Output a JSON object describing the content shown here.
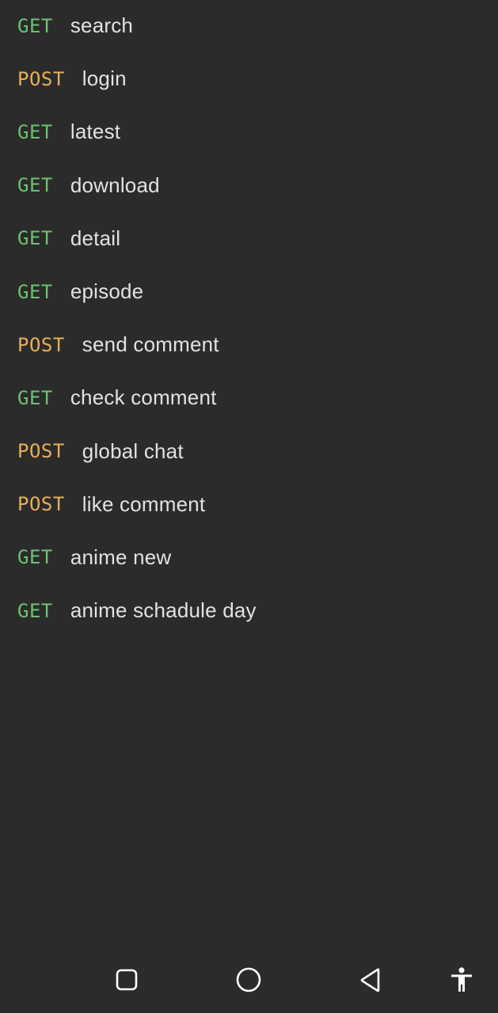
{
  "endpoints": [
    {
      "method": "GET",
      "name": "search"
    },
    {
      "method": "POST",
      "name": "login"
    },
    {
      "method": "GET",
      "name": "latest"
    },
    {
      "method": "GET",
      "name": "download"
    },
    {
      "method": "GET",
      "name": "detail"
    },
    {
      "method": "GET",
      "name": "episode"
    },
    {
      "method": "POST",
      "name": "send comment"
    },
    {
      "method": "GET",
      "name": "check comment"
    },
    {
      "method": "POST",
      "name": "global chat"
    },
    {
      "method": "POST",
      "name": "like comment"
    },
    {
      "method": "GET",
      "name": "anime new"
    },
    {
      "method": "GET",
      "name": "anime schadule day"
    }
  ],
  "colors": {
    "background": "#2b2b2b",
    "get": "#6cc36f",
    "post": "#e8ad5a",
    "text": "#e2e2e2",
    "nav_icon": "#ffffff"
  },
  "nav": {
    "buttons": [
      "recent-apps-icon",
      "home-icon",
      "back-icon",
      "accessibility-icon"
    ]
  }
}
